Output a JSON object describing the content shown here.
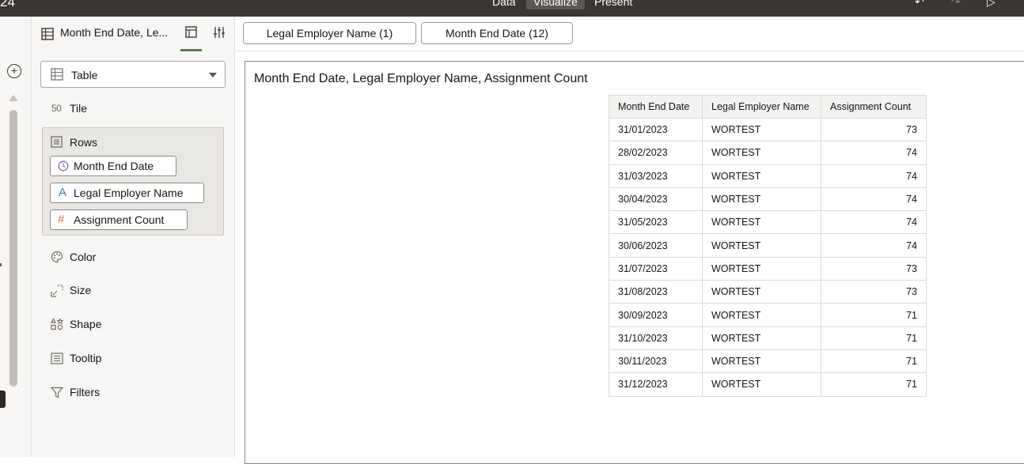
{
  "topbar": {
    "left_text": "24",
    "tabs": [
      "Data",
      "Visualize",
      "Present"
    ],
    "active_tab": "Visualize"
  },
  "panel": {
    "viz_title": "Month End Date, Le...",
    "viz_type": "Table",
    "tile_label": "Tile",
    "rows_label": "Rows",
    "row_items": [
      {
        "label": "Month End Date",
        "icon": "clock-icon"
      },
      {
        "label": "Legal Employer Name",
        "icon": "text-attribute-icon"
      },
      {
        "label": "Assignment Count",
        "icon": "hash-icon"
      }
    ],
    "color_label": "Color",
    "size_label": "Size",
    "shape_label": "Shape",
    "tooltip_label": "Tooltip",
    "filters_label": "Filters"
  },
  "filters": [
    {
      "label": "Legal Employer Name (1)"
    },
    {
      "label": "Month End Date (12)"
    }
  ],
  "canvas": {
    "title": "Month End Date, Legal Employer Name, Assignment Count"
  },
  "table": {
    "columns": [
      "Month End Date",
      "Legal Employer Name",
      "Assignment Count"
    ],
    "rows": [
      [
        "31/01/2023",
        "WORTEST",
        "73"
      ],
      [
        "28/02/2023",
        "WORTEST",
        "74"
      ],
      [
        "31/03/2023",
        "WORTEST",
        "74"
      ],
      [
        "30/04/2023",
        "WORTEST",
        "74"
      ],
      [
        "31/05/2023",
        "WORTEST",
        "74"
      ],
      [
        "30/06/2023",
        "WORTEST",
        "74"
      ],
      [
        "31/07/2023",
        "WORTEST",
        "73"
      ],
      [
        "31/08/2023",
        "WORTEST",
        "73"
      ],
      [
        "30/09/2023",
        "WORTEST",
        "71"
      ],
      [
        "31/10/2023",
        "WORTEST",
        "71"
      ],
      [
        "30/11/2023",
        "WORTEST",
        "71"
      ],
      [
        "31/12/2023",
        "WORTEST",
        "71"
      ]
    ]
  },
  "colors": {
    "topbar_bg": "#3a3632",
    "active_underline": "#5b7a4e",
    "date_icon": "#8a6bb0",
    "text_icon": "#4a7ab0",
    "number_icon": "#d86a4c"
  }
}
